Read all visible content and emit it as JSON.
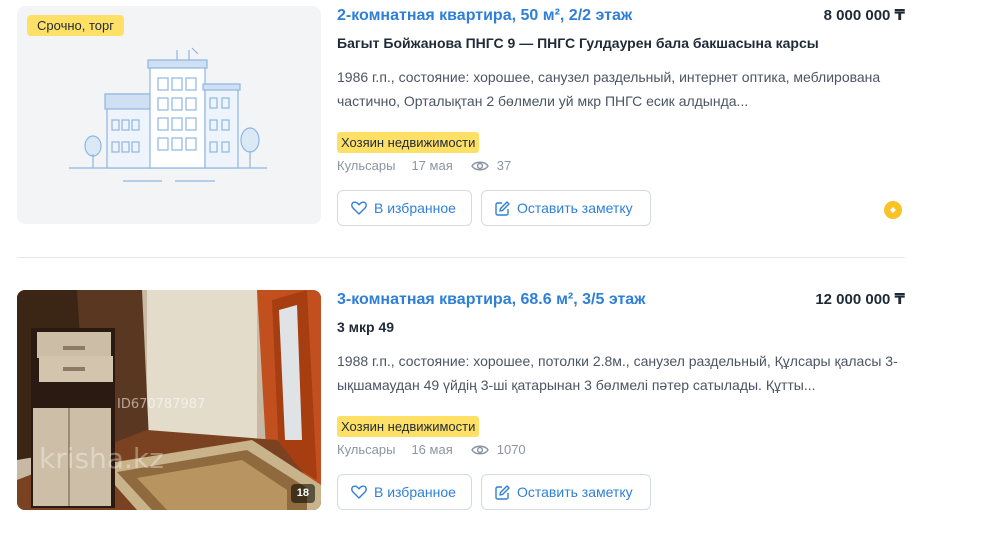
{
  "listings": [
    {
      "badge": "Срочно, торг",
      "title": "2-комнатная квартира, 50 м², 2/2 этаж",
      "price": "8 000 000 ₸",
      "address": "Багыт Бойжанова ПНГС 9 — ПНГС Гулдаурен бала бакшасына карсы",
      "description": "1986 г.п., состояние: хорошее, санузел раздельный, интернет оптика, меблирована частично, Орталықтан 2 бөлмели уй мкр ПНГС есик алдында...",
      "owner_label": "Хозяин недвижимости",
      "city": "Кульсары",
      "date": "17 мая",
      "views": "37",
      "favorite_label": "В избранное",
      "note_label": "Оставить заметку",
      "image": "building-placeholder-icon"
    },
    {
      "title": "3-комнатная квартира, 68.6 м², 3/5 этаж",
      "price": "12 000 000 ₸",
      "address": "3 мкр 49",
      "description": "1988 г.п., состояние: хорошее, потолки 2.8м., санузел раздельный, Құлсары қаласы 3-ықшамаудан 49 үйдің 3-ші қатарынан 3 бөлмелі пәтер сатылады. Құтты...",
      "owner_label": "Хозяин недвижимости",
      "city": "Кульсары",
      "date": "16 мая",
      "views": "1070",
      "favorite_label": "В избранное",
      "note_label": "Оставить заметку",
      "photo_count": "18",
      "watermark_id": "ID670787987",
      "watermark_brand": "krisha.kz"
    }
  ],
  "colors": {
    "title": "#2f7fd8",
    "badge": "#ffe066",
    "promo": "#f7c325"
  }
}
